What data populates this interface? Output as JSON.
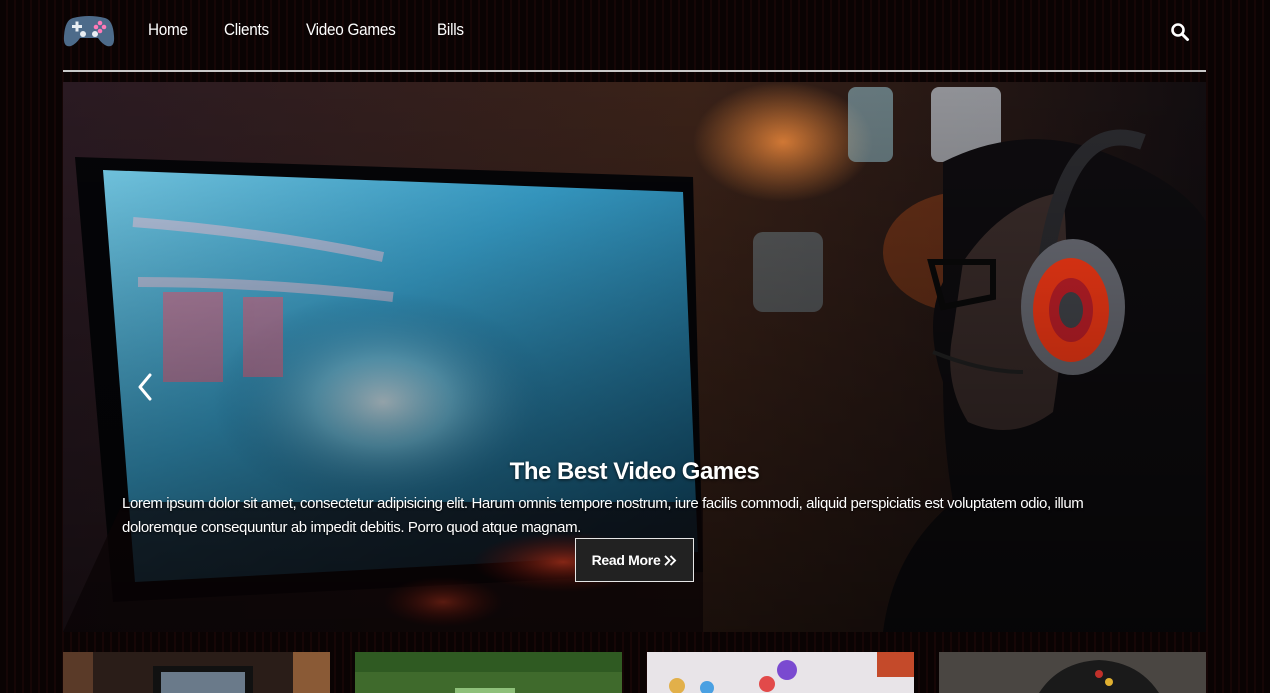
{
  "header": {
    "logo_icon": "gamepad-icon",
    "nav": [
      {
        "label": "Home"
      },
      {
        "label": "Clients"
      },
      {
        "label": "Video Games"
      },
      {
        "label": "Bills"
      }
    ],
    "search_icon": "search-icon"
  },
  "hero": {
    "title": "The Best Video Games",
    "text": "Lorem ipsum dolor sit amet, consectetur adipisicing elit. Harum omnis tempore nostrum, iure facilis commodi, aliquid perspiciatis est voluptatem odio, illum doloremque consequuntur ab impedit debitis. Porro quod atque magnam.",
    "button_label": "Read More",
    "button_icon": "double-chevron-right-icon",
    "prev_icon": "chevron-left-icon"
  },
  "colors": {
    "background": "#0d0404",
    "divider": "#c9c9c9",
    "button_bg": "#222222",
    "button_border": "#e6e6e6"
  }
}
